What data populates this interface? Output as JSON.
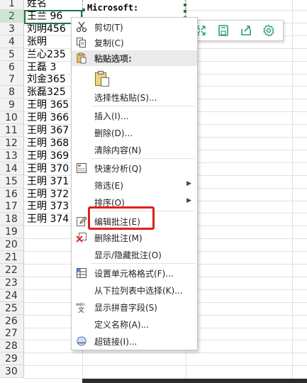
{
  "rows": [
    {
      "n": "1",
      "v": "姓名"
    },
    {
      "n": "2",
      "v": "王兰    96"
    },
    {
      "n": "3",
      "v": "刘明456"
    },
    {
      "n": "4",
      "v": "张明"
    },
    {
      "n": "5",
      "v": "兰心235"
    },
    {
      "n": "6",
      "v": "王磊     3"
    },
    {
      "n": "7",
      "v": "刘金365"
    },
    {
      "n": "8",
      "v": "张磊325"
    },
    {
      "n": "9",
      "v": "王明  365"
    },
    {
      "n": "10",
      "v": "王明  366"
    },
    {
      "n": "11",
      "v": "王明  367"
    },
    {
      "n": "12",
      "v": "王明  368"
    },
    {
      "n": "13",
      "v": "王明  369"
    },
    {
      "n": "14",
      "v": "王明  370"
    },
    {
      "n": "15",
      "v": "王明  371"
    },
    {
      "n": "16",
      "v": "王明  372"
    },
    {
      "n": "17",
      "v": "王明  373"
    },
    {
      "n": "18",
      "v": "王明  374"
    },
    {
      "n": "19",
      "v": ""
    },
    {
      "n": "20",
      "v": ""
    },
    {
      "n": "21",
      "v": ""
    },
    {
      "n": "22",
      "v": ""
    },
    {
      "n": "23",
      "v": ""
    },
    {
      "n": "24",
      "v": ""
    },
    {
      "n": "25",
      "v": ""
    },
    {
      "n": "26",
      "v": ""
    },
    {
      "n": "27",
      "v": ""
    },
    {
      "n": "28",
      "v": ""
    },
    {
      "n": "29",
      "v": ""
    },
    {
      "n": "30",
      "v": ""
    }
  ],
  "comment": {
    "text": "Microsoft:"
  },
  "toolbar": {
    "icons": [
      "search-icon",
      "copy-doc-icon",
      "expand-icon",
      "save-icon",
      "share-icon",
      "settings-icon"
    ]
  },
  "menu": {
    "items": [
      {
        "label": "剪切(T)",
        "icon": "scissors-icon"
      },
      {
        "label": "复制(C)",
        "icon": "copy-icon"
      },
      {
        "label": "粘贴选项:",
        "icon": "paste-icon",
        "header": true
      },
      {
        "label": "",
        "icon": "paste-clipboard-icon"
      },
      {
        "label": "选择性粘贴(S)...",
        "icon": ""
      },
      {
        "label": "插入(I)...",
        "icon": ""
      },
      {
        "label": "删除(D)...",
        "icon": ""
      },
      {
        "label": "清除内容(N)",
        "icon": ""
      },
      {
        "label": "快速分析(Q)",
        "icon": "quick-analysis-icon"
      },
      {
        "label": "筛选(E)",
        "icon": "",
        "submenu": true
      },
      {
        "label": "排序(O)",
        "icon": "",
        "submenu": true
      },
      {
        "label": "编辑批注(E)",
        "icon": "edit-comment-icon"
      },
      {
        "label": "删除批注(M)",
        "icon": "delete-comment-icon"
      },
      {
        "label": "显示/隐藏批注(O)",
        "icon": ""
      },
      {
        "label": "设置单元格格式(F)...",
        "icon": "format-cells-icon"
      },
      {
        "label": "从下拉列表中选择(K)...",
        "icon": ""
      },
      {
        "label": "显示拼音字段(S)",
        "icon": "phonetic-icon"
      },
      {
        "label": "定义名称(A)...",
        "icon": ""
      },
      {
        "label": "超链接(I)...",
        "icon": "hyperlink-icon"
      }
    ]
  },
  "colors": {
    "accent": "#217346",
    "highlight": "#e0201d"
  }
}
